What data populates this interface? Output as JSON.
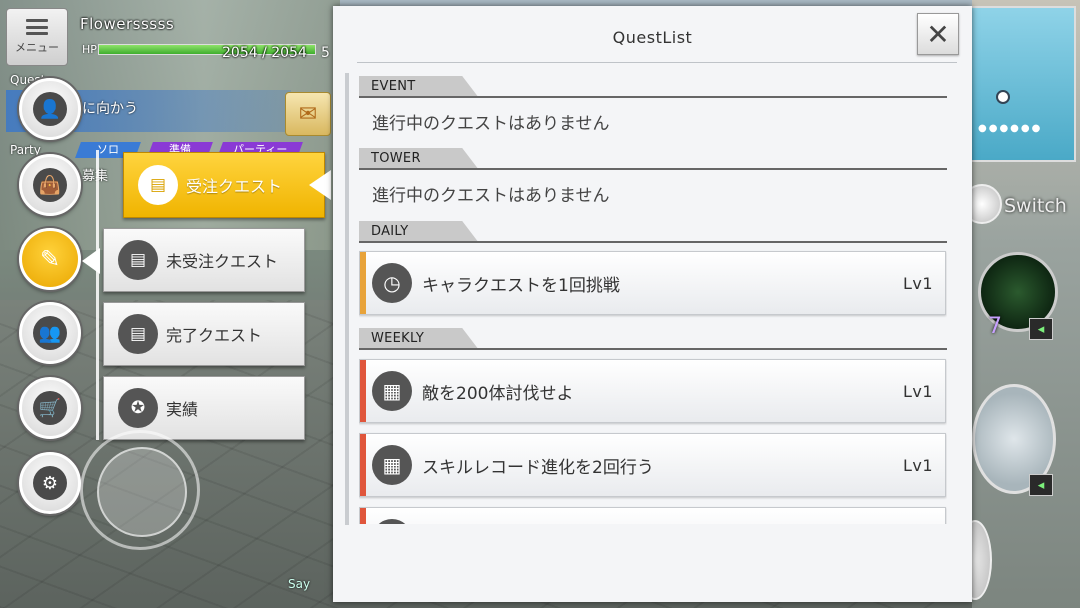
{
  "hud": {
    "menu_label": "メニュー",
    "player_name": "Flowersssss",
    "hp_label": "HP",
    "hp_value": "2054 / 2054",
    "hp_fraction": 1.0,
    "sp_partial": "5",
    "quest_tag": "Quest",
    "quest_text": "に向かう",
    "party_label": "Party",
    "party_tabs": [
      "ソロ",
      "準備",
      "パーティー"
    ],
    "recruit_text": "募集",
    "say_label": "Say",
    "switch_label": "Switch",
    "skill_number": "7"
  },
  "side_menu": {
    "buttons": [
      {
        "name": "profile",
        "icon": "person-icon",
        "glyph": "👤"
      },
      {
        "name": "inventory",
        "icon": "bag-icon",
        "glyph": "👜"
      },
      {
        "name": "quest",
        "icon": "quest-scroll-icon",
        "glyph": "✎",
        "active": true
      },
      {
        "name": "friends",
        "icon": "friends-icon",
        "glyph": "👥"
      },
      {
        "name": "shop",
        "icon": "cart-icon",
        "glyph": "🛒"
      },
      {
        "name": "settings",
        "icon": "gear-icon",
        "glyph": "⚙"
      }
    ],
    "sub_items": [
      {
        "label": "受注クエスト",
        "icon": "document-icon",
        "glyph": "▤",
        "selected": true
      },
      {
        "label": "未受注クエスト",
        "icon": "document-info-icon",
        "glyph": "▤"
      },
      {
        "label": "完了クエスト",
        "icon": "document-check-icon",
        "glyph": "▤"
      },
      {
        "label": "実績",
        "icon": "medal-icon",
        "glyph": "✪"
      }
    ]
  },
  "panel": {
    "title": "QuestList",
    "close_glyph": "✕",
    "sections": [
      {
        "header": "EVENT",
        "empty_text": "進行中のクエストはありません"
      },
      {
        "header": "TOWER",
        "empty_text": "進行中のクエストはありません"
      },
      {
        "header": "DAILY"
      },
      {
        "header": "WEEKLY"
      }
    ],
    "daily_items": [
      {
        "name": "キャラクエストを1回挑戦",
        "level": "Lv1",
        "icon": "clock-icon",
        "glyph": "◷",
        "stripe": "#e8a33a"
      }
    ],
    "weekly_items": [
      {
        "name": "敵を200体討伐せよ",
        "level": "Lv1",
        "icon": "calendar-icon",
        "glyph": "▦",
        "stripe": "#e0563c"
      },
      {
        "name": "スキルレコード進化を2回行う",
        "level": "Lv1",
        "icon": "calendar-icon",
        "glyph": "▦",
        "stripe": "#e0563c"
      },
      {
        "name": "",
        "level": "",
        "icon": "calendar-icon",
        "glyph": "▦",
        "stripe": "#e0563c"
      }
    ]
  },
  "colors": {
    "accent_yellow": "#f0b400",
    "daily_stripe": "#e8a33a",
    "weekly_stripe": "#e0563c",
    "hp_green": "#3fae2e"
  }
}
